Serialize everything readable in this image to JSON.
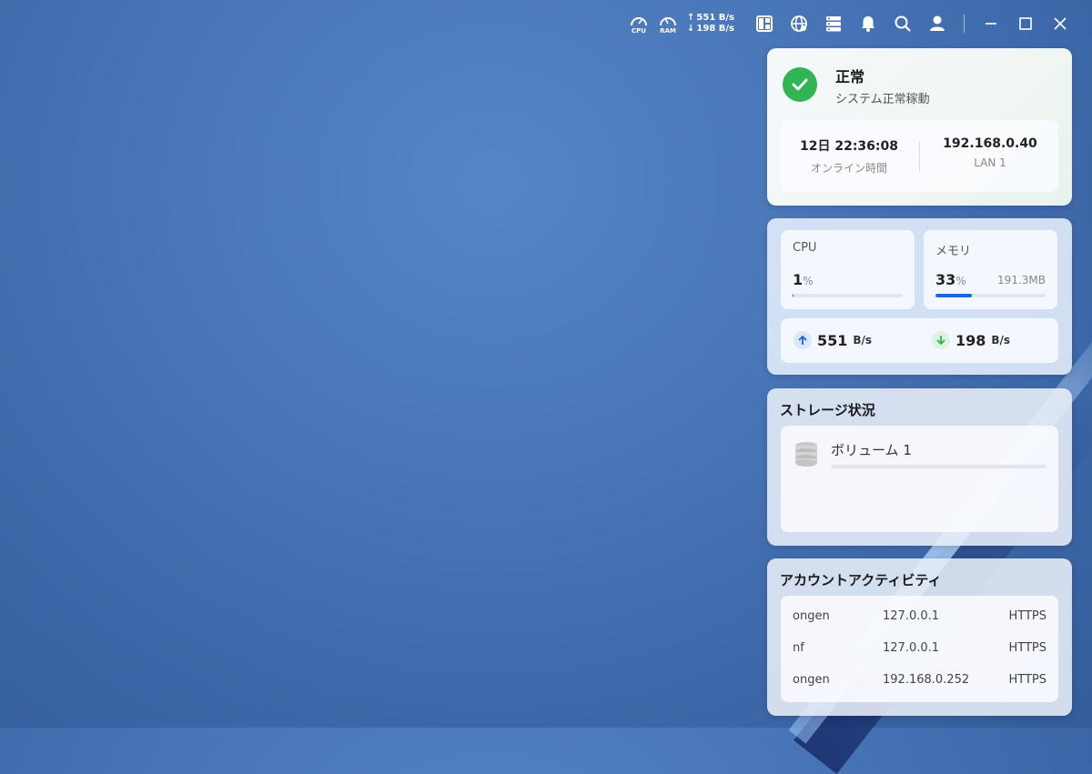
{
  "topbar": {
    "gauges": [
      {
        "label": "CPU"
      },
      {
        "label": "RAM"
      }
    ],
    "upload_speed": "551 B/s",
    "download_speed": "198 B/s",
    "icons": [
      "widget-panel-icon",
      "network-icon",
      "server-icon",
      "notification-icon",
      "search-icon",
      "user-icon"
    ]
  },
  "status": {
    "title": "正常",
    "subtitle": "システム正常稼動",
    "uptime_value": "12日 22:36:08",
    "uptime_label": "オンライン時間",
    "ip_value": "192.168.0.40",
    "ip_label": "LAN 1"
  },
  "resources": {
    "cpu": {
      "label": "CPU",
      "value": "1",
      "unit": "%",
      "percent": 1
    },
    "memory": {
      "label": "メモリ",
      "value": "33",
      "unit": "%",
      "used": "191.3MB",
      "percent": 33
    },
    "upload": {
      "value": "551",
      "unit": "B/s"
    },
    "download": {
      "value": "198",
      "unit": "B/s"
    }
  },
  "storage": {
    "title": "ストレージ状況",
    "volume_name": "ボリューム 1"
  },
  "account_activity": {
    "title": "アカウントアクティビティ",
    "rows": [
      {
        "user": "ongen",
        "ip": "127.0.0.1",
        "protocol": "HTTPS"
      },
      {
        "user": "nf",
        "ip": "127.0.0.1",
        "protocol": "HTTPS"
      },
      {
        "user": "ongen",
        "ip": "192.168.0.252",
        "protocol": "HTTPS"
      }
    ]
  },
  "colors": {
    "accent": "#1e64e0",
    "ok": "#2fb552"
  }
}
